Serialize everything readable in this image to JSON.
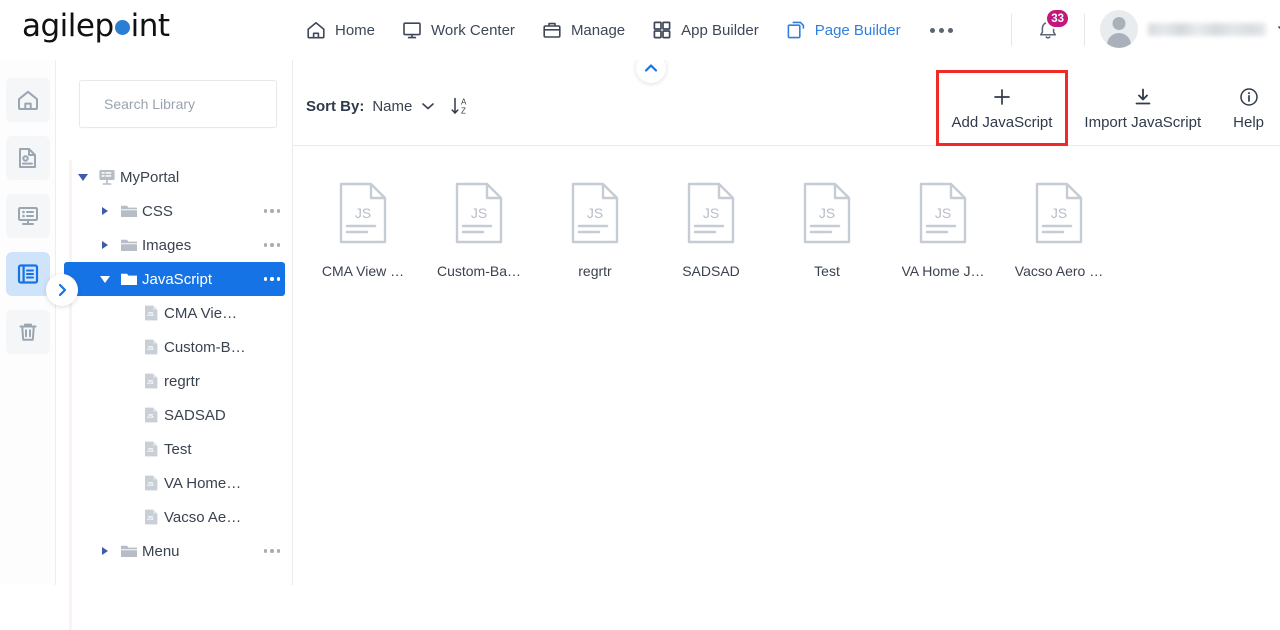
{
  "brand": {
    "name_part1": "agilep",
    "name_part2": "int"
  },
  "topnav": {
    "items": [
      {
        "label": "Home",
        "icon": "home-icon",
        "active": false
      },
      {
        "label": "Work Center",
        "icon": "monitor-icon",
        "active": false
      },
      {
        "label": "Manage",
        "icon": "briefcase-icon",
        "active": false
      },
      {
        "label": "App Builder",
        "icon": "grid-icon",
        "active": false
      },
      {
        "label": "Page Builder",
        "icon": "pages-icon",
        "active": true
      }
    ],
    "more_label": "",
    "notifications_count": "33",
    "notifications_badge_color": "#c2187e",
    "accent_color": "#2f7fe0"
  },
  "rail": {
    "items": [
      {
        "name": "home",
        "icon": "home-icon",
        "active": false
      },
      {
        "name": "page",
        "icon": "page-icon",
        "active": false
      },
      {
        "name": "form",
        "icon": "form-icon",
        "active": false
      },
      {
        "name": "library",
        "icon": "library-icon",
        "active": true
      },
      {
        "name": "recycle-bin",
        "icon": "trash-icon",
        "active": false
      }
    ],
    "expand_icon": "chevron-right-icon"
  },
  "library": {
    "search": {
      "placeholder": "Search Library",
      "value": "",
      "icon": "search-icon"
    },
    "tree": [
      {
        "label": "MyPortal",
        "indent": 0,
        "caret": "open",
        "icon": "portal-icon",
        "selected": false,
        "dots": false
      },
      {
        "label": "CSS",
        "indent": 1,
        "caret": "closed",
        "icon": "folder-icon",
        "selected": false,
        "dots": true
      },
      {
        "label": "Images",
        "indent": 1,
        "caret": "closed",
        "icon": "folder-icon",
        "selected": false,
        "dots": true
      },
      {
        "label": "JavaScript",
        "indent": 1,
        "caret": "open",
        "icon": "folder-icon",
        "selected": true,
        "dots": true
      },
      {
        "label": "CMA Vie…",
        "indent": 2,
        "caret": "none",
        "icon": "js-file-icon",
        "selected": false,
        "dots": false
      },
      {
        "label": "Custom-B…",
        "indent": 2,
        "caret": "none",
        "icon": "js-file-icon",
        "selected": false,
        "dots": false
      },
      {
        "label": "regrtr",
        "indent": 2,
        "caret": "none",
        "icon": "js-file-icon",
        "selected": false,
        "dots": false
      },
      {
        "label": "SADSAD",
        "indent": 2,
        "caret": "none",
        "icon": "js-file-icon",
        "selected": false,
        "dots": false
      },
      {
        "label": "Test",
        "indent": 2,
        "caret": "none",
        "icon": "js-file-icon",
        "selected": false,
        "dots": false
      },
      {
        "label": "VA Home…",
        "indent": 2,
        "caret": "none",
        "icon": "js-file-icon",
        "selected": false,
        "dots": false
      },
      {
        "label": "Vacso Ae…",
        "indent": 2,
        "caret": "none",
        "icon": "js-file-icon",
        "selected": false,
        "dots": false
      },
      {
        "label": "Menu",
        "indent": 1,
        "caret": "closed",
        "icon": "folder-icon",
        "selected": false,
        "dots": true
      }
    ]
  },
  "toolbar": {
    "sort_by_label": "Sort By:",
    "sort_by_value": "Name",
    "sort_direction_icon": "sort-az-descending-icon",
    "actions": [
      {
        "label": "Add JavaScript",
        "icon": "plus-icon",
        "highlighted": true
      },
      {
        "label": "Import JavaScript",
        "icon": "import-icon",
        "highlighted": false
      },
      {
        "label": "Help",
        "icon": "info-icon",
        "highlighted": false
      }
    ],
    "collapse_icon": "chevron-up-icon",
    "highlight_color": "#ee2b26"
  },
  "files": [
    {
      "label": "CMA View …",
      "type": "JS"
    },
    {
      "label": "Custom-Ba…",
      "type": "JS"
    },
    {
      "label": "regrtr",
      "type": "JS"
    },
    {
      "label": "SADSAD",
      "type": "JS"
    },
    {
      "label": "Test",
      "type": "JS"
    },
    {
      "label": "VA Home J…",
      "type": "JS"
    },
    {
      "label": "Vacso Aero …",
      "type": "JS"
    }
  ]
}
